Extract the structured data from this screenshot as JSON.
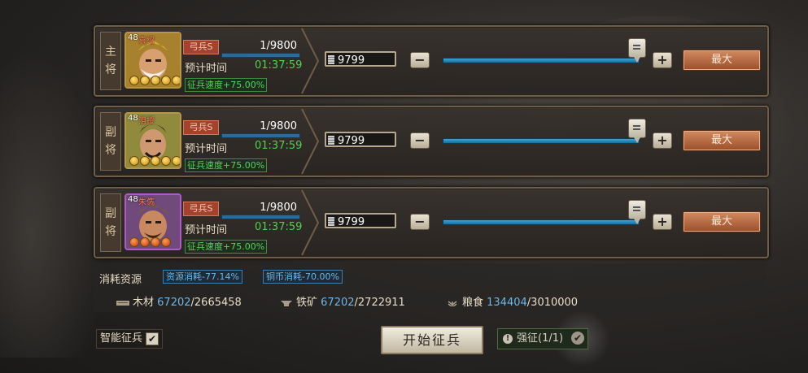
{
  "generals": [
    {
      "role_top": "主",
      "role_bottom": "将",
      "level": "48",
      "name": "袁绍",
      "troop_type": "弓兵S",
      "count": "1/9800",
      "eta_label": "预计时间",
      "eta": "01:37:59",
      "speed": "征兵速度+75.00%",
      "quantity": "9799",
      "max_label": "最大",
      "slider_fraction": 1.0
    },
    {
      "role_top": "副",
      "role_bottom": "将",
      "level": "48",
      "name": "沮授",
      "troop_type": "弓兵S",
      "count": "1/9800",
      "eta_label": "预计时间",
      "eta": "01:37:59",
      "speed": "征兵速度+75.00%",
      "quantity": "9799",
      "max_label": "最大",
      "slider_fraction": 1.0
    },
    {
      "role_top": "副",
      "role_bottom": "将",
      "level": "48",
      "name": "朱儁",
      "troop_type": "弓兵S",
      "count": "1/9800",
      "eta_label": "预计时间",
      "eta": "01:37:59",
      "speed": "征兵速度+75.00%",
      "quantity": "9799",
      "max_label": "最大",
      "slider_fraction": 1.0
    }
  ],
  "resources": {
    "title": "消耗资源",
    "discount_resource": "资源消耗-77.14%",
    "discount_copper": "铜币消耗-70.00%",
    "wood": {
      "label": "木材",
      "have": "67202",
      "total": "/2665458"
    },
    "iron": {
      "label": "铁矿",
      "have": "67202",
      "total": "/2722911"
    },
    "grain": {
      "label": "粮食",
      "have": "134404",
      "total": "/3010000"
    }
  },
  "footer": {
    "smart_label": "智能征兵",
    "start_label": "开始征兵",
    "force_label": "强征(1/1)"
  },
  "icons": {
    "minus": "−",
    "plus": "+",
    "check": "✔",
    "warn": "!"
  }
}
